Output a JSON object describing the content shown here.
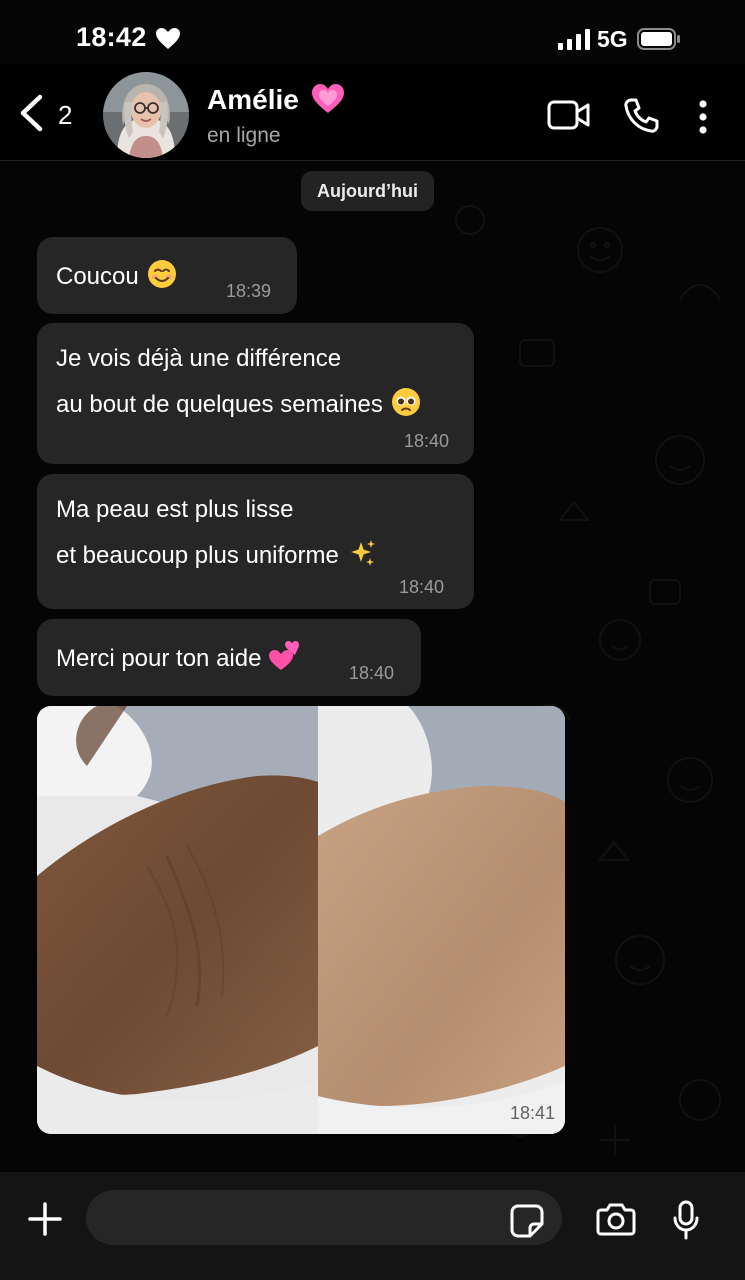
{
  "status_bar": {
    "time": "18:42",
    "network": "5G"
  },
  "header": {
    "back_count": "2",
    "contact_name": "Amélie",
    "contact_status": "en ligne"
  },
  "date_separator": "Aujourd’hui",
  "messages": [
    {
      "lines": [
        "Coucou"
      ],
      "emoji": "smiling-face-icon",
      "time": "18:39"
    },
    {
      "lines": [
        "Je vois déjà une différence",
        "au bout de quelques semaines"
      ],
      "emoji": "pleading-face-icon",
      "time": "18:40"
    },
    {
      "lines": [
        "Ma peau est plus lisse",
        "et beaucoup plus uniforme"
      ],
      "emoji": "sparkles-icon",
      "time": "18:40"
    },
    {
      "lines": [
        "Merci pour ton aide"
      ],
      "emoji": "two-hearts-icon",
      "time": "18:40"
    }
  ],
  "photo_message": {
    "time": "18:41"
  },
  "input": {
    "placeholder": ""
  },
  "colors": {
    "background": "#050505",
    "bubble": "#262626",
    "muted_text": "#9a9a9a",
    "pink_heart": "#ff4fb3"
  }
}
